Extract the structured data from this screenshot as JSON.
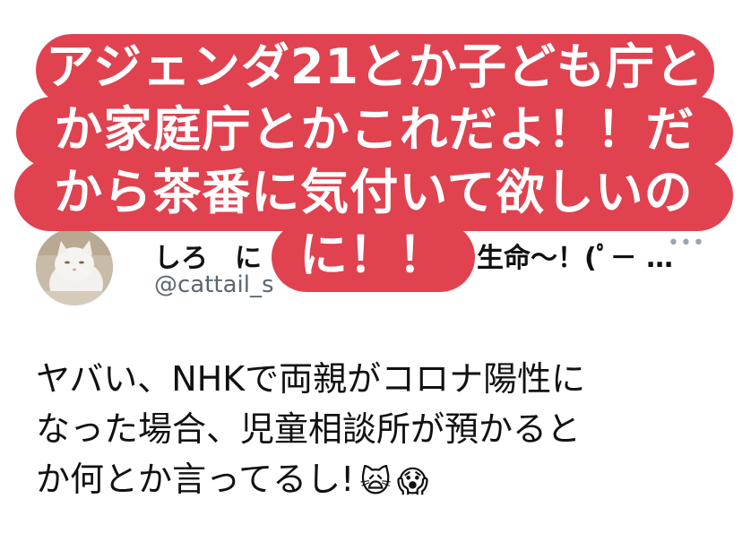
{
  "caption": {
    "lines": [
      "アジェンダ21とか子ども庁と",
      "か家庭庁とかこれだよ！！だ",
      "から茶番に気付いて欲しいの",
      "に！！"
    ],
    "color": "#e0424f"
  },
  "tweet": {
    "display_name": "しろ　に　　　　　　　　生命〜！(ﾟ－ …",
    "username": "@cattail_s",
    "avatar_icon": "cat-avatar",
    "more_icon": "more-dots-icon",
    "body_lines": [
      "ヤバい、NHKで両親がコロナ陽性に",
      "なった場合、児童相談所が預かると",
      "か何とか言ってるし!"
    ],
    "emojis": [
      "🙀",
      "😱"
    ]
  }
}
